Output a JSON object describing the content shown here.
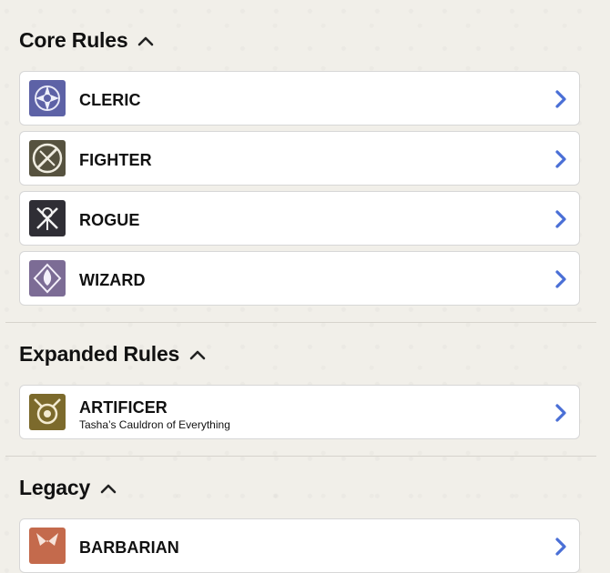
{
  "colors": {
    "accent": "#4a6fd6",
    "divider": "#d6d3cc"
  },
  "sections": [
    {
      "title": "Core Rules",
      "toggle_icon": "chevron-up-icon",
      "items": [
        {
          "name": "CLERIC",
          "icon": "cleric-class-icon"
        },
        {
          "name": "FIGHTER",
          "icon": "fighter-class-icon"
        },
        {
          "name": "ROGUE",
          "icon": "rogue-class-icon"
        },
        {
          "name": "WIZARD",
          "icon": "wizard-class-icon"
        }
      ]
    },
    {
      "title": "Expanded Rules",
      "toggle_icon": "chevron-up-icon",
      "items": [
        {
          "name": "ARTIFICER",
          "subtitle": "Tasha’s Cauldron of Everything",
          "icon": "artificer-class-icon"
        }
      ]
    },
    {
      "title": "Legacy",
      "toggle_icon": "chevron-up-icon",
      "items": [
        {
          "name": "BARBARIAN",
          "icon": "barbarian-class-icon"
        }
      ]
    }
  ]
}
